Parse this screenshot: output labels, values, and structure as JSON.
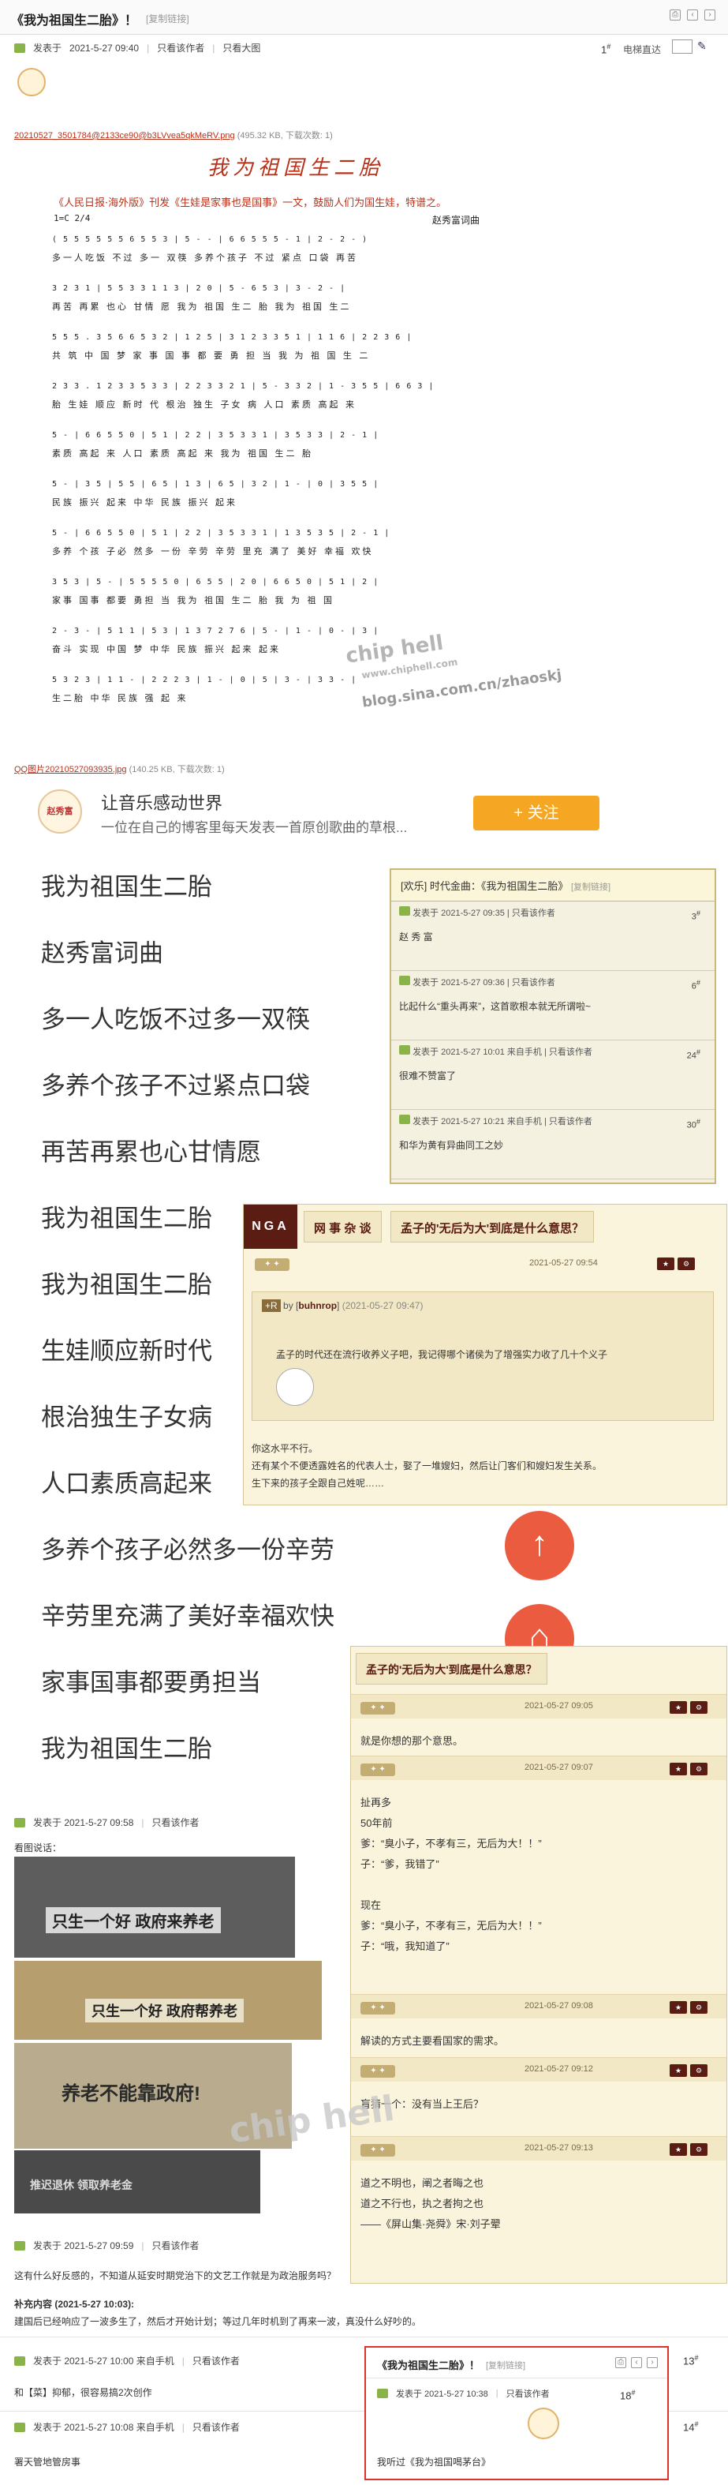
{
  "topbar": {
    "title": "《我为祖国生二胎》！",
    "copy_link": "[复制链接]"
  },
  "post1": {
    "meta_prefix": "发表于",
    "time": "2021-5-27 09:40",
    "only_author": "只看该作者",
    "big_image": "只看大图",
    "floor": "1",
    "elevator": "电梯直达",
    "attachment1": "20210527_3501784@2133ce90@b3LVvea5qkMeRV.png",
    "attachment1_info": "(495.32 KB, 下载次数: 1)",
    "attachment2": "QQ图片20210527093935.jpg",
    "attachment2_info": "(140.25 KB, 下载次数: 1)"
  },
  "score": {
    "title": "我为祖国生二胎",
    "subtitle": "《人民日报·海外版》刊发《生娃是家事也是国事》一文，鼓励人们为国生娃，特谱之。",
    "key": "1=C    2/4",
    "composer": "赵秀富词曲",
    "staff_lines": [
      "( 5 5 5 5  5 5  6 5 5 3 | 5 -  - | 6 6 5 5  5 - 1 | 2 - 2 - )",
      "3  2 3 1 | 5 5 3 3  1 1 3 | 2 0 | 5 - 6 5  3 | 3 - 2 - |",
      "5 5 5 . 3  5 6 6  5 3  2 | 1 2 5 | 3 1 2 3  3 5 1 | 1 1 6 | 2 2 3 6 |",
      "2 3 3 . 1 2 3  3 5 3 3 | 2 2 3 3 2 1 | 5 - 3 3 2 | 1 - 3 5 5 | 6 6 3 |",
      "5 - | 6 6 5 5 0 | 5 1 | 2 2 | 3 5 3 3 1 | 3 5 3 3 | 2 - 1 |",
      "5 - | 3 5 | 5 5 | 6 5 | 1 3 | 6 5 | 3 2 | 1 - | 0 | 3 5 5 |",
      "5 - | 6 6 5 5 0 | 5 1 | 2 2 | 3 5 3 3 1 | 1 3 5 3 5 | 2 - 1 |",
      "3 5 3 | 5 - | 5 5 5 5 0 | 6 5 5 | 2 0 | 6 6 5 0 | 5 1 | 2 |",
      "2 - 3 - | 5 1 1 | 5 3 | 1 3 7 2 7 6 | 5 - | 1 - | 0 - | 3 |",
      "5 3 2 3 | 1 1 - | 2 2 2 3 | 1 - | 0 | 5 | 3 - | 3 3 - |"
    ],
    "lyric_lines": [
      "多一人吃饭 不过 多一 双筷  多养个孩子 不过 紧点 口袋  再苦",
      "再苦 再累 也心 甘情 愿 我为 祖国 生二 胎 我为 祖国 生二",
      "共 筑 中 国 梦 家 事 国 事 都 要 勇 担 当 我 为 祖 国 生 二",
      "胎  生娃 顺应 新时 代  根治 独生 子女 病  人口 素质 高起 来",
      "素质 高起 来  人口 素质 高起 来  我为 祖国 生二 胎",
      "民族 振兴 起来  中华 民族 振兴 起来",
      "多养 个孩 子必 然多 一份 辛劳  辛劳 里充 满了 美好 幸福 欢快",
      "家事 国事 都要 勇担 当  我为 祖国 生二 胎 我 为 祖 国",
      "奋斗 实现  中国  梦  中华 民族 振兴 起来 起来",
      "生二胎 中华 民族 强 起 来"
    ],
    "watermark_site": "www.chiphell.com",
    "watermark_blog": "blog.sina.com.cn/zhaoskj"
  },
  "banner": {
    "avatar_text": "赵秀富",
    "title": "让音乐感动世界",
    "desc": "一位在自己的博客里每天发表一首原创歌曲的草根...",
    "follow": "+ 关注"
  },
  "lyrics": [
    "我为祖国生二胎",
    "赵秀富词曲",
    "多一人吃饭不过多一双筷",
    "多养个孩子不过紧点口袋",
    "再苦再累也心甘情愿",
    "我为祖国生二胎",
    "我为祖国生二胎",
    "生娃顺应新时代",
    "根治独生子女病",
    "人口素质高起来",
    "多养个孩子必然多一份辛劳",
    "辛劳里充满了美好幸福欢快",
    "家事国事都要勇担当",
    "我为祖国生二胎"
  ],
  "forum1": {
    "title": "[欢乐] 时代金曲：《我为祖国生二胎》",
    "copy_link": "[复制链接]",
    "rows": [
      {
        "time": "发表于 2021-5-27 09:35",
        "only": "只看该作者",
        "floor": "3",
        "text": "赵 秀 富"
      },
      {
        "time": "发表于 2021-5-27 09:36",
        "only": "只看该作者",
        "floor": "6",
        "text": "比起什么“重头再来”，这首歌根本就无所谓啦~"
      },
      {
        "time": "发表于 2021-5-27 10:01 来自手机",
        "only": "只看该作者",
        "floor": "24",
        "text": "很难不赞富了"
      },
      {
        "time": "发表于 2021-5-27 10:21 来自手机",
        "only": "只看该作者",
        "floor": "30",
        "text": "和华为黄有异曲同工之妙"
      }
    ]
  },
  "nga": {
    "logo": "NGA",
    "tab1": "网 事 杂 谈",
    "tab2": "孟子的'无后为大'到底是什么意思？",
    "badge": "",
    "time": "2021-05-27 09:54",
    "quote_user": "buhnrop",
    "quote_time": "(2021-05-27 09:47)",
    "quote_text": "孟子的时代还在流行收养义子吧，我记得哪个诸侯为了增强实力收了几十个义子",
    "reply_lines": [
      "你这水平不行。",
      "还有某个不便透露姓名的代表人士，娶了一堆嫂妇，然后让门客们和嫂妇发生关系。",
      "生下来的孩子全跟自己姓呢……"
    ]
  },
  "nga2": {
    "title": "孟子的'无后为大'到底是什么意思？",
    "rows": [
      {
        "time": "2021-05-27 09:05",
        "body": "就是你想的那个意思。"
      },
      {
        "time": "2021-05-27 09:07",
        "body": "扯再多\n50年前\n爹：“臭小子，不孝有三，无后为大！！”\n子：“爹，我错了”\n\n现在\n爹：“臭小子，不孝有三，无后为大！！”\n子：“哦，我知道了”"
      },
      {
        "time": "2021-05-27 09:08",
        "body": "解读的方式主要看国家的需求。"
      },
      {
        "time": "2021-05-27 09:12",
        "body": "盲猜一个：没有当上王后？"
      },
      {
        "time": "2021-05-27 09:13",
        "body": "道之不明也，阐之者晦之也\n道之不行也，执之者拘之也\n——《屏山集·尧舜》宋·刘子翚"
      }
    ]
  },
  "post2": {
    "time": "发表于 2021-5-27 09:58",
    "only": "只看该作者",
    "caption": "看图说话：",
    "photo_texts": [
      "只生一个好 政府来养老",
      "只生一个好 政府帮养老",
      "养老不能靠政府!",
      "推迟退休 领取养老金"
    ]
  },
  "post3": {
    "time": "发表于 2021-5-27 09:59",
    "only": "只看该作者",
    "text": "这有什么好反感的，不知道从延安时期党治下的文艺工作就是为政治服务吗？",
    "supp_label": "补充内容 (2021-5-27 10:03):",
    "supp_text": "建国后已经响应了一波多生了，然后才开始计划；等过几年时机到了再来一波，真没什么好吵的。"
  },
  "post4": {
    "time": "发表于 2021-5-27 10:00 来自手机",
    "only": "只看该作者",
    "floor": "13",
    "text": "和【菜】抑郁，很容易搞2次创作"
  },
  "post5": {
    "time": "发表于 2021-5-27 10:08 来自手机",
    "only": "只看该作者",
    "floor": "14",
    "text": "署天管地管房事"
  },
  "popup": {
    "title": "《我为祖国生二胎》！",
    "copy_link": "[复制链接]",
    "time": "发表于 2021-5-27 10:38",
    "only": "只看该作者",
    "floor": "18",
    "text": "我听过《我为祖国喝茅台》"
  },
  "colors": {
    "accent_red": "#e0322d",
    "fab_red": "#ea5b40",
    "follow_orange": "#f5a623",
    "nga_brown": "#5a1c13",
    "forum_border": "#c9b979",
    "link_red": "#b8321a"
  },
  "icons": [
    "print-icon",
    "prev-icon",
    "next-icon",
    "close-icon",
    "pen-icon",
    "post-icon",
    "up-arrow-icon",
    "home-icon"
  ]
}
